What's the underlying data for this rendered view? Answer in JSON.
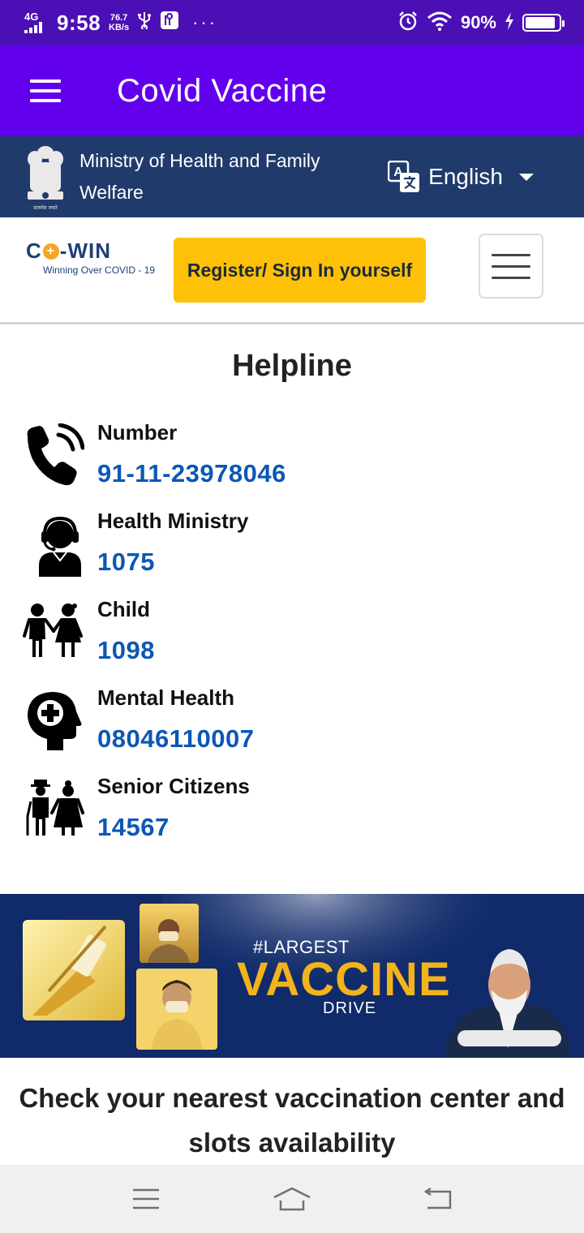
{
  "status_bar": {
    "network": "4G",
    "time": "9:58",
    "speed_value": "76.7",
    "speed_unit": "KB/s",
    "more": "···",
    "battery_pct": "90%",
    "battery_level": 0.9
  },
  "app_bar": {
    "title": "Covid Vaccine"
  },
  "ministry": {
    "name": "Ministry of Health and Family Welfare",
    "emblem_text": "सत्यमेव जयते",
    "language": "English"
  },
  "nav": {
    "logo_main_left": "C",
    "logo_main_right": "-WIN",
    "logo_sub": "Winning Over COVID - 19",
    "register_label": "Register/ Sign In yourself"
  },
  "helpline": {
    "title": "Helpline",
    "items": [
      {
        "label": "Number",
        "number": "91-11-23978046",
        "icon": "phone-icon"
      },
      {
        "label": "Health Ministry",
        "number": "1075",
        "icon": "headset-person-icon"
      },
      {
        "label": "Child",
        "number": "1098",
        "icon": "children-icon"
      },
      {
        "label": "Mental Health",
        "number": "08046110007",
        "icon": "head-plus-icon"
      },
      {
        "label": "Senior Citizens",
        "number": "14567",
        "icon": "elderly-couple-icon"
      }
    ]
  },
  "banner": {
    "tag": "#LARGEST",
    "main": "VACCINE",
    "sub": "DRIVE"
  },
  "check": {
    "text": "Check your nearest vaccination center and slots availability"
  },
  "colors": {
    "status_bar": "#4a10b5",
    "app_bar": "#6200ee",
    "ministry_bar": "#203a6c",
    "register_button": "#ffc107",
    "helpline_number": "#0b57b5",
    "banner_bg": "#102a6a",
    "banner_accent": "#f2b31b"
  }
}
